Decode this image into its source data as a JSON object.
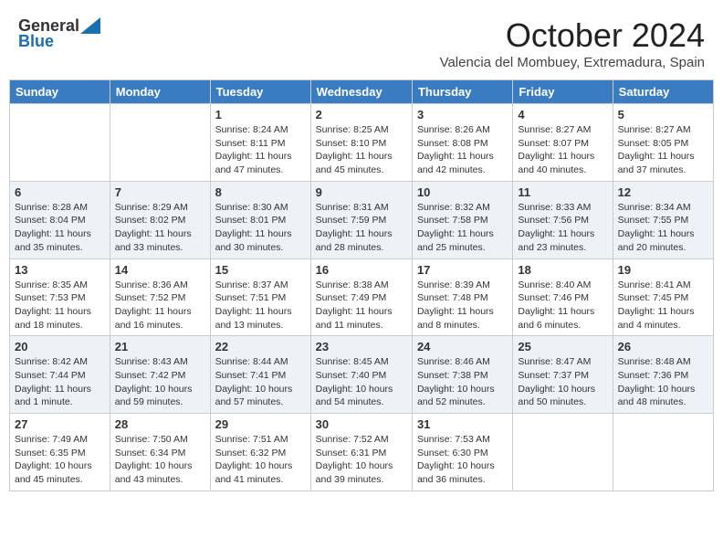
{
  "header": {
    "logo_general": "General",
    "logo_blue": "Blue",
    "month_title": "October 2024",
    "location": "Valencia del Mombuey, Extremadura, Spain"
  },
  "weekdays": [
    "Sunday",
    "Monday",
    "Tuesday",
    "Wednesday",
    "Thursday",
    "Friday",
    "Saturday"
  ],
  "weeks": [
    [
      {
        "day": "",
        "sunrise": "",
        "sunset": "",
        "daylight": ""
      },
      {
        "day": "",
        "sunrise": "",
        "sunset": "",
        "daylight": ""
      },
      {
        "day": "1",
        "sunrise": "Sunrise: 8:24 AM",
        "sunset": "Sunset: 8:11 PM",
        "daylight": "Daylight: 11 hours and 47 minutes."
      },
      {
        "day": "2",
        "sunrise": "Sunrise: 8:25 AM",
        "sunset": "Sunset: 8:10 PM",
        "daylight": "Daylight: 11 hours and 45 minutes."
      },
      {
        "day": "3",
        "sunrise": "Sunrise: 8:26 AM",
        "sunset": "Sunset: 8:08 PM",
        "daylight": "Daylight: 11 hours and 42 minutes."
      },
      {
        "day": "4",
        "sunrise": "Sunrise: 8:27 AM",
        "sunset": "Sunset: 8:07 PM",
        "daylight": "Daylight: 11 hours and 40 minutes."
      },
      {
        "day": "5",
        "sunrise": "Sunrise: 8:27 AM",
        "sunset": "Sunset: 8:05 PM",
        "daylight": "Daylight: 11 hours and 37 minutes."
      }
    ],
    [
      {
        "day": "6",
        "sunrise": "Sunrise: 8:28 AM",
        "sunset": "Sunset: 8:04 PM",
        "daylight": "Daylight: 11 hours and 35 minutes."
      },
      {
        "day": "7",
        "sunrise": "Sunrise: 8:29 AM",
        "sunset": "Sunset: 8:02 PM",
        "daylight": "Daylight: 11 hours and 33 minutes."
      },
      {
        "day": "8",
        "sunrise": "Sunrise: 8:30 AM",
        "sunset": "Sunset: 8:01 PM",
        "daylight": "Daylight: 11 hours and 30 minutes."
      },
      {
        "day": "9",
        "sunrise": "Sunrise: 8:31 AM",
        "sunset": "Sunset: 7:59 PM",
        "daylight": "Daylight: 11 hours and 28 minutes."
      },
      {
        "day": "10",
        "sunrise": "Sunrise: 8:32 AM",
        "sunset": "Sunset: 7:58 PM",
        "daylight": "Daylight: 11 hours and 25 minutes."
      },
      {
        "day": "11",
        "sunrise": "Sunrise: 8:33 AM",
        "sunset": "Sunset: 7:56 PM",
        "daylight": "Daylight: 11 hours and 23 minutes."
      },
      {
        "day": "12",
        "sunrise": "Sunrise: 8:34 AM",
        "sunset": "Sunset: 7:55 PM",
        "daylight": "Daylight: 11 hours and 20 minutes."
      }
    ],
    [
      {
        "day": "13",
        "sunrise": "Sunrise: 8:35 AM",
        "sunset": "Sunset: 7:53 PM",
        "daylight": "Daylight: 11 hours and 18 minutes."
      },
      {
        "day": "14",
        "sunrise": "Sunrise: 8:36 AM",
        "sunset": "Sunset: 7:52 PM",
        "daylight": "Daylight: 11 hours and 16 minutes."
      },
      {
        "day": "15",
        "sunrise": "Sunrise: 8:37 AM",
        "sunset": "Sunset: 7:51 PM",
        "daylight": "Daylight: 11 hours and 13 minutes."
      },
      {
        "day": "16",
        "sunrise": "Sunrise: 8:38 AM",
        "sunset": "Sunset: 7:49 PM",
        "daylight": "Daylight: 11 hours and 11 minutes."
      },
      {
        "day": "17",
        "sunrise": "Sunrise: 8:39 AM",
        "sunset": "Sunset: 7:48 PM",
        "daylight": "Daylight: 11 hours and 8 minutes."
      },
      {
        "day": "18",
        "sunrise": "Sunrise: 8:40 AM",
        "sunset": "Sunset: 7:46 PM",
        "daylight": "Daylight: 11 hours and 6 minutes."
      },
      {
        "day": "19",
        "sunrise": "Sunrise: 8:41 AM",
        "sunset": "Sunset: 7:45 PM",
        "daylight": "Daylight: 11 hours and 4 minutes."
      }
    ],
    [
      {
        "day": "20",
        "sunrise": "Sunrise: 8:42 AM",
        "sunset": "Sunset: 7:44 PM",
        "daylight": "Daylight: 11 hours and 1 minute."
      },
      {
        "day": "21",
        "sunrise": "Sunrise: 8:43 AM",
        "sunset": "Sunset: 7:42 PM",
        "daylight": "Daylight: 10 hours and 59 minutes."
      },
      {
        "day": "22",
        "sunrise": "Sunrise: 8:44 AM",
        "sunset": "Sunset: 7:41 PM",
        "daylight": "Daylight: 10 hours and 57 minutes."
      },
      {
        "day": "23",
        "sunrise": "Sunrise: 8:45 AM",
        "sunset": "Sunset: 7:40 PM",
        "daylight": "Daylight: 10 hours and 54 minutes."
      },
      {
        "day": "24",
        "sunrise": "Sunrise: 8:46 AM",
        "sunset": "Sunset: 7:38 PM",
        "daylight": "Daylight: 10 hours and 52 minutes."
      },
      {
        "day": "25",
        "sunrise": "Sunrise: 8:47 AM",
        "sunset": "Sunset: 7:37 PM",
        "daylight": "Daylight: 10 hours and 50 minutes."
      },
      {
        "day": "26",
        "sunrise": "Sunrise: 8:48 AM",
        "sunset": "Sunset: 7:36 PM",
        "daylight": "Daylight: 10 hours and 48 minutes."
      }
    ],
    [
      {
        "day": "27",
        "sunrise": "Sunrise: 7:49 AM",
        "sunset": "Sunset: 6:35 PM",
        "daylight": "Daylight: 10 hours and 45 minutes."
      },
      {
        "day": "28",
        "sunrise": "Sunrise: 7:50 AM",
        "sunset": "Sunset: 6:34 PM",
        "daylight": "Daylight: 10 hours and 43 minutes."
      },
      {
        "day": "29",
        "sunrise": "Sunrise: 7:51 AM",
        "sunset": "Sunset: 6:32 PM",
        "daylight": "Daylight: 10 hours and 41 minutes."
      },
      {
        "day": "30",
        "sunrise": "Sunrise: 7:52 AM",
        "sunset": "Sunset: 6:31 PM",
        "daylight": "Daylight: 10 hours and 39 minutes."
      },
      {
        "day": "31",
        "sunrise": "Sunrise: 7:53 AM",
        "sunset": "Sunset: 6:30 PM",
        "daylight": "Daylight: 10 hours and 36 minutes."
      },
      {
        "day": "",
        "sunrise": "",
        "sunset": "",
        "daylight": ""
      },
      {
        "day": "",
        "sunrise": "",
        "sunset": "",
        "daylight": ""
      }
    ]
  ]
}
